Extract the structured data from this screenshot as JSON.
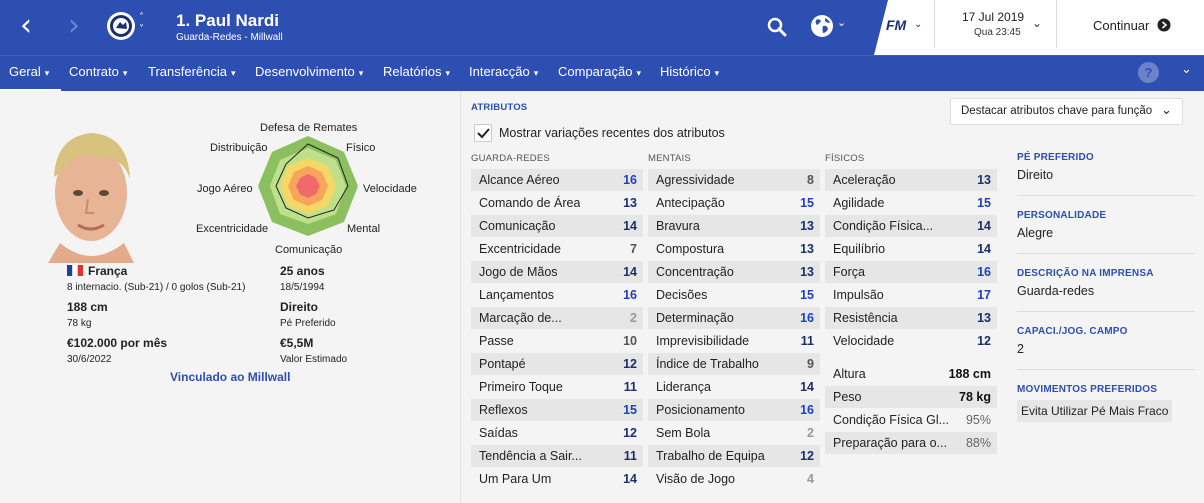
{
  "header": {
    "player_title": "1. Paul Nardi",
    "subtitle": "Guarda-Redes - Millwall",
    "fm_logo": "FM",
    "date": "17 Jul 2019",
    "day_time": "Qua 23:45",
    "continue_label": "Continuar",
    "accent": "#2d4fb1"
  },
  "tabs": [
    {
      "label": "Geral"
    },
    {
      "label": "Contrato"
    },
    {
      "label": "Transferência"
    },
    {
      "label": "Desenvolvimento"
    },
    {
      "label": "Relatórios"
    },
    {
      "label": "Interacção"
    },
    {
      "label": "Comparação"
    },
    {
      "label": "Histórico"
    }
  ],
  "help_label": "?",
  "radar": {
    "labels": [
      "Defesa de Remates",
      "Físico",
      "Velocidade",
      "Mental",
      "Comunicação",
      "Excentricidade",
      "Jogo Aéreo",
      "Distribuição"
    ]
  },
  "profile": {
    "nationality": "França",
    "caps": "8 internacio. (Sub-21) / 0 golos (Sub-21)",
    "age": "25 anos",
    "dob": "18/5/1994",
    "height": "188 cm",
    "weight": "78 kg",
    "foot": "Direito",
    "foot_label": "Pé Preferido",
    "wage": "€102.000 por mês",
    "contract_end": "30/6/2022",
    "value": "€5,5M",
    "value_label": "Valor Estimado",
    "linked": "Vinculado ao Millwall"
  },
  "attributes": {
    "title": "ATRIBUTOS",
    "highlight_dropdown": "Destacar atributos chave para função",
    "show_changes_label": "Mostrar variações recentes dos atributos",
    "show_changes_checked": true,
    "goalkeeping_title": "GUARDA-REDES",
    "mental_title": "MENTAIS",
    "physical_title": "FÍSICOS",
    "goalkeeping": [
      {
        "name": "Alcance Aéreo",
        "value": "16"
      },
      {
        "name": "Comando de Área",
        "value": "13"
      },
      {
        "name": "Comunicação",
        "value": "14"
      },
      {
        "name": "Excentricidade",
        "value": "7"
      },
      {
        "name": "Jogo de Mãos",
        "value": "14"
      },
      {
        "name": "Lançamentos",
        "value": "16"
      },
      {
        "name": "Marcação de...",
        "value": "2"
      },
      {
        "name": "Passe",
        "value": "10"
      },
      {
        "name": "Pontapé",
        "value": "12"
      },
      {
        "name": "Primeiro Toque",
        "value": "11"
      },
      {
        "name": "Reflexos",
        "value": "15"
      },
      {
        "name": "Saídas",
        "value": "12"
      },
      {
        "name": "Tendência a Sair...",
        "value": "11"
      },
      {
        "name": "Um Para Um",
        "value": "14"
      }
    ],
    "mental": [
      {
        "name": "Agressividade",
        "value": "8"
      },
      {
        "name": "Antecipação",
        "value": "15"
      },
      {
        "name": "Bravura",
        "value": "13"
      },
      {
        "name": "Compostura",
        "value": "13"
      },
      {
        "name": "Concentração",
        "value": "13"
      },
      {
        "name": "Decisões",
        "value": "15"
      },
      {
        "name": "Determinação",
        "value": "16"
      },
      {
        "name": "Imprevisibilidade",
        "value": "11"
      },
      {
        "name": "Índice de Trabalho",
        "value": "9"
      },
      {
        "name": "Liderança",
        "value": "14"
      },
      {
        "name": "Posicionamento",
        "value": "16"
      },
      {
        "name": "Sem Bola",
        "value": "2"
      },
      {
        "name": "Trabalho de Equipa",
        "value": "12"
      },
      {
        "name": "Visão de Jogo",
        "value": "4"
      }
    ],
    "physical": [
      {
        "name": "Aceleração",
        "value": "13"
      },
      {
        "name": "Agilidade",
        "value": "15"
      },
      {
        "name": "Condição Física...",
        "value": "14"
      },
      {
        "name": "Equilíbrio",
        "value": "14"
      },
      {
        "name": "Força",
        "value": "16"
      },
      {
        "name": "Impulsão",
        "value": "17"
      },
      {
        "name": "Resistência",
        "value": "13"
      },
      {
        "name": "Velocidade",
        "value": "12"
      }
    ],
    "physical_extra": [
      {
        "name": "Altura",
        "value": "188 cm"
      },
      {
        "name": "Peso",
        "value": "78 kg"
      },
      {
        "name": "Condição Física Gl...",
        "value": "95%"
      },
      {
        "name": "Preparação para o...",
        "value": "88%"
      }
    ]
  },
  "side": {
    "foot_title": "PÉ PREFERIDO",
    "foot_value": "Direito",
    "personality_title": "PERSONALIDADE",
    "personality_value": "Alegre",
    "press_title": "DESCRIÇÃO NA IMPRENSA",
    "press_value": "Guarda-redes",
    "capacity_title": "CAPACI./JOG. CAMPO",
    "capacity_value": "2",
    "moves_title": "MOVIMENTOS PREFERIDOS",
    "moves_value": "Evita Utilizar Pé Mais Fraco"
  }
}
